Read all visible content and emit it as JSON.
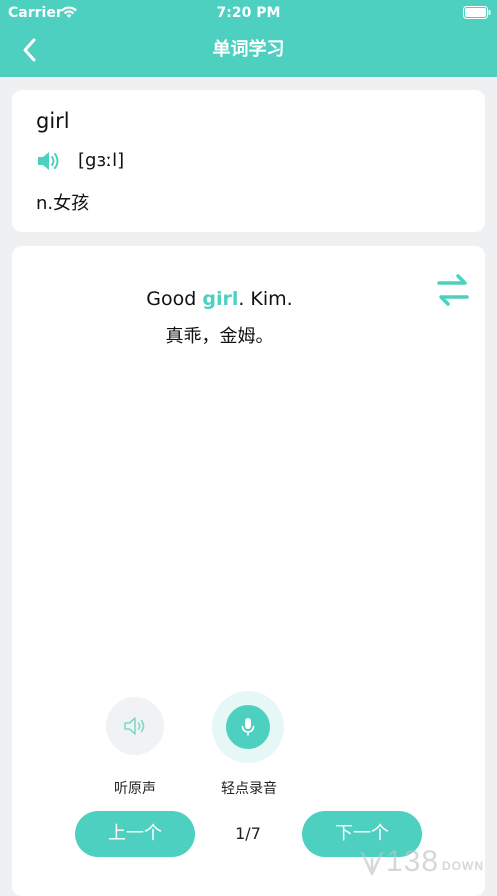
{
  "status_bar": {
    "carrier": "Carrier",
    "time": "7:20 PM"
  },
  "header": {
    "title": "单词学习"
  },
  "word_card": {
    "word": "girl",
    "phonetic": "[gɜːl]",
    "meaning": "n.女孩"
  },
  "sentence_card": {
    "english_before": "Good ",
    "english_highlight": "girl",
    "english_after": ". Kim.",
    "chinese": "真乖，金姆。"
  },
  "controls": {
    "listen_label": "听原声",
    "record_label": "轻点录音",
    "prev_label": "上一个",
    "next_label": "下一个",
    "page_indicator": "1/7"
  },
  "watermark": {
    "number": "138",
    "suffix": "DOWN"
  },
  "colors": {
    "accent": "#4dd0c0",
    "background": "#eef0f2",
    "card": "#ffffff"
  },
  "icons": {
    "back": "chevron-left-icon",
    "speaker": "speaker-icon",
    "swap": "swap-icon",
    "mic": "mic-icon"
  }
}
